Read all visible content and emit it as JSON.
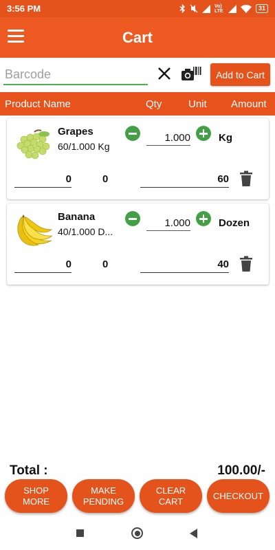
{
  "status_bar": {
    "time": "3:56 PM",
    "network": "Vo) LTE",
    "battery": "31"
  },
  "app_bar": {
    "title": "Cart"
  },
  "search": {
    "placeholder": "Barcode",
    "value": "",
    "add_button": "Add to Cart"
  },
  "columns": {
    "product_name": "Product Name",
    "qty": "Qty",
    "unit": "Unit",
    "amount": "Amount"
  },
  "cart_items": [
    {
      "name": "Grapes",
      "subtitle": "60/1.000 Kg",
      "qty": "1.000",
      "unit": "Kg",
      "field_1": "0",
      "field_2": "0",
      "amount": "60",
      "icon": "grapes-image"
    },
    {
      "name": "Banana",
      "subtitle": "40/1.000 D...",
      "qty": "1.000",
      "unit": "Dozen",
      "field_1": "0",
      "field_2": "0",
      "amount": "40",
      "icon": "banana-image"
    }
  ],
  "total": {
    "label": "Total :",
    "value": "100.00/-"
  },
  "actions": {
    "shop_more": "SHOP MORE",
    "make_pending": "MAKE PENDING",
    "clear_cart": "CLEAR CART",
    "checkout": "CHECKOUT"
  },
  "colors": {
    "primary": "#ed5a22",
    "header": "#e8521c",
    "stepper": "#43a047",
    "input_underline": "#4caf50"
  }
}
